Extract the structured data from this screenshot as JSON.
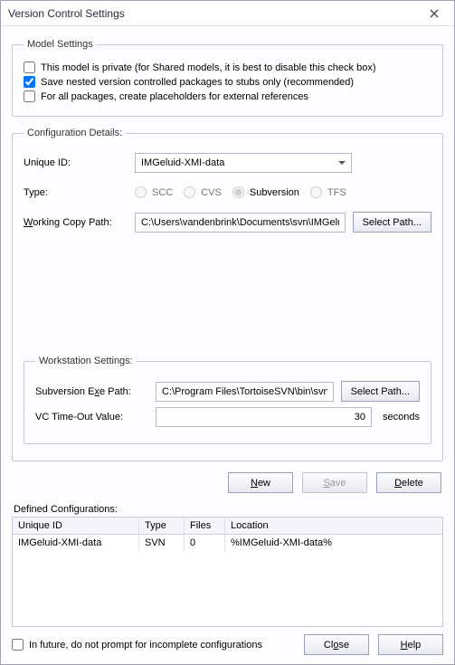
{
  "window": {
    "title": "Version Control Settings"
  },
  "model_settings": {
    "legend": "Model Settings",
    "private_label": "This model is private (for Shared models, it is best to disable this check box)",
    "stubs_label": "Save nested version controlled packages to stubs only (recommended)",
    "placeholders_label": "For all packages, create placeholders for external references"
  },
  "config": {
    "legend": "Configuration Details:",
    "unique_id_label": "Unique ID:",
    "unique_id_value": "IMGeluid-XMI-data",
    "type_label": "Type:",
    "radio_scc": "SCC",
    "radio_cvs": "CVS",
    "radio_subversion": "Subversion",
    "radio_tfs": "TFS",
    "working_copy_label_pre": "W",
    "working_copy_label": "orking Copy Path:",
    "working_copy_value": "C:\\Users\\vandenbrink\\Documents\\svn\\IMGeluid",
    "select_path_btn": "Select Path..."
  },
  "workstation": {
    "legend": "Workstation Settings:",
    "exe_label_pre": "Subversion E",
    "exe_label_u": "x",
    "exe_label_post": "e Path:",
    "exe_value": "C:\\Program Files\\TortoiseSVN\\bin\\svn.exe",
    "select_path_btn": "Select Path...",
    "timeout_label": "VC Time-Out Value:",
    "timeout_value": "30",
    "timeout_unit": "seconds"
  },
  "buttons": {
    "new_u": "N",
    "new": "ew",
    "save_u": "S",
    "save": "ave",
    "delete_u": "D",
    "delete": "elete",
    "close_pre": "Cl",
    "close_u": "o",
    "close_post": "se",
    "help_u": "H",
    "help": "elp"
  },
  "defined": {
    "label": "Defined Configurations:",
    "col_id": "Unique ID",
    "col_type": "Type",
    "col_files": "Files",
    "col_loc": "Location",
    "rows": {
      "r0": {
        "id": "IMGeluid-XMI-data",
        "type": "SVN",
        "files": "0",
        "loc": "%IMGeluid-XMI-data%"
      }
    }
  },
  "footer": {
    "future_label": "In future, do not prompt for incomplete configurations"
  }
}
